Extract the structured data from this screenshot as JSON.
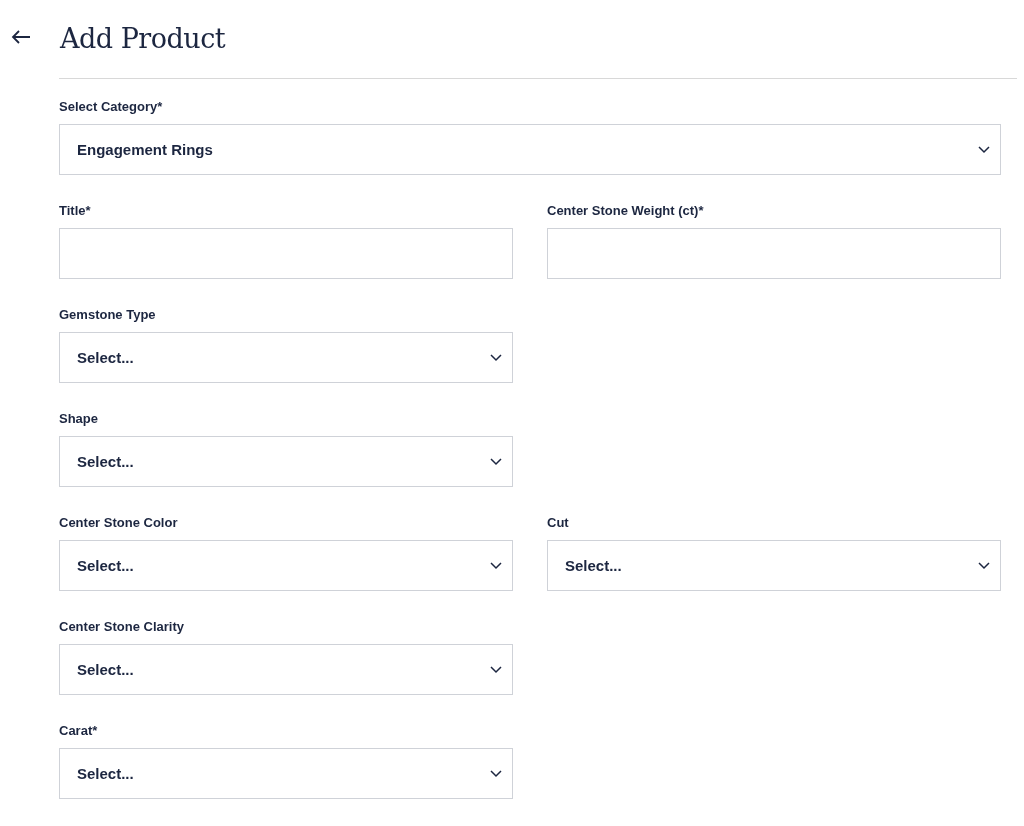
{
  "header": {
    "title": "Add Product"
  },
  "category": {
    "label": "Select Category*",
    "kind": "select",
    "value": "Engagement Rings"
  },
  "rows": [
    {
      "fields": [
        {
          "label": "Title*",
          "kind": "text"
        },
        {
          "label": "Center Stone Weight (ct)*",
          "kind": "text"
        }
      ]
    },
    {
      "fields": [
        {
          "label": "Gemstone Type",
          "kind": "select",
          "value": "Select..."
        }
      ]
    },
    {
      "fields": [
        {
          "label": "Shape",
          "kind": "select",
          "value": "Select..."
        }
      ]
    },
    {
      "fields": [
        {
          "label": "Center Stone Color",
          "kind": "select",
          "value": "Select..."
        },
        {
          "label": "Cut",
          "kind": "select",
          "value": "Select..."
        }
      ]
    },
    {
      "fields": [
        {
          "label": "Center Stone Clarity",
          "kind": "select",
          "value": "Select..."
        }
      ]
    },
    {
      "fields": [
        {
          "label": "Carat*",
          "kind": "select",
          "value": "Select..."
        }
      ]
    }
  ]
}
